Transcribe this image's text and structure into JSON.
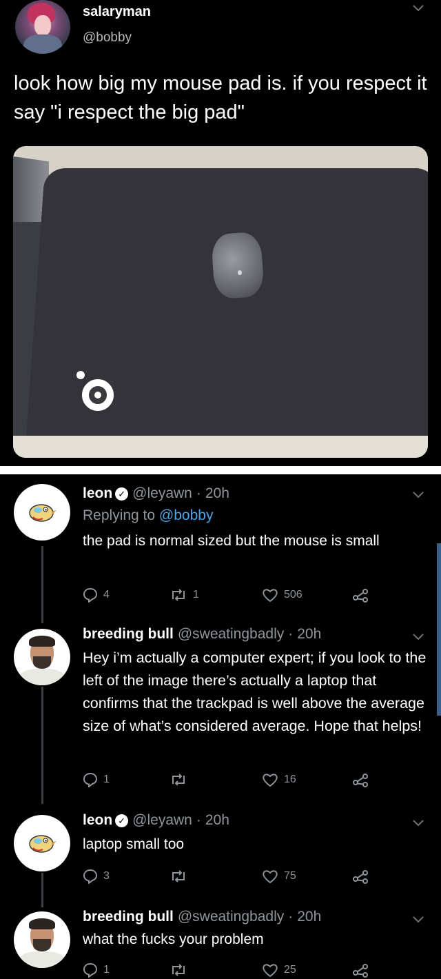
{
  "original_post": {
    "display_name": "salaryman",
    "handle": "@bobby",
    "text": "look how big my mouse pad is. if you respect it say \"i respect the big pad\""
  },
  "replies": [
    {
      "display_name": "leon",
      "verified": true,
      "handle": "@leyawn",
      "sep": "·",
      "time": "20h",
      "replying_prefix": "Replying to",
      "replying_to": "@bobby",
      "text": "the pad is normal sized but the mouse is small",
      "reply_count": "4",
      "retweet_count": "1",
      "like_count": "506"
    },
    {
      "display_name": "breeding bull",
      "verified": false,
      "handle": "@sweatingbadly",
      "sep": "·",
      "time": "20h",
      "text": "Hey i’m actually a computer expert; if you look to the left of the image there’s actually a laptop that confirms that the trackpad is well above the average size of what’s considered average. Hope that helps!",
      "reply_count": "1",
      "retweet_count": "",
      "like_count": "16"
    },
    {
      "display_name": "leon",
      "verified": true,
      "handle": "@leyawn",
      "sep": "·",
      "time": "20h",
      "text": "laptop small too",
      "reply_count": "3",
      "retweet_count": "",
      "like_count": "75"
    },
    {
      "display_name": "breeding bull",
      "verified": false,
      "handle": "@sweatingbadly",
      "sep": "·",
      "time": "20h",
      "text": "what the fucks your problem",
      "reply_count": "1",
      "retweet_count": "",
      "like_count": "25"
    }
  ],
  "icons": {
    "reply": "comment-icon",
    "retweet": "retweet-icon",
    "like": "heart-icon",
    "share": "share-icon",
    "menu": "chevron-down-icon",
    "verified": "verified-badge-icon"
  },
  "colors": {
    "background": "#000000",
    "link": "#4aa6e9",
    "muted": "#8f959b"
  }
}
